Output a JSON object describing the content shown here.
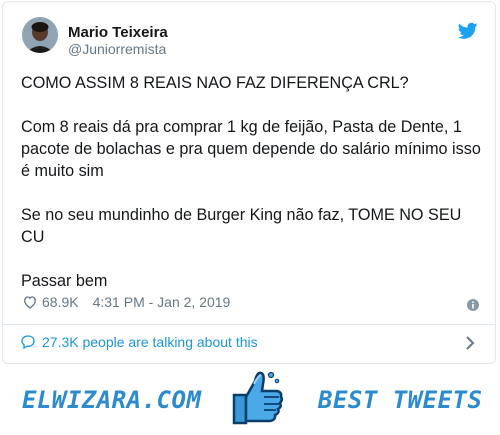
{
  "tweet": {
    "display_name": "Mario Teixeira",
    "handle": "@Juniorremista",
    "lines": [
      "COMO ASSIM 8 REAIS NAO FAZ DIFERENÇA CRL?",
      "Com 8 reais dá pra comprar 1 kg de feijão, Pasta de Dente, 1 pacote de bolachas e pra quem depende do salário mínimo isso é muito sim",
      "Se no seu mundinho de Burger King não faz, TOME NO SEU CU",
      "Passar bem"
    ],
    "likes": "68.9K",
    "timestamp": "4:31 PM - Jan 2, 2019",
    "talking": "27.3K people are talking about this"
  },
  "footer": {
    "left_brand": "ELWIZARA.COM",
    "right_brand": "BEST TWEETS"
  },
  "colors": {
    "accent": "#1da1f2",
    "link": "#1b95e0",
    "brand": "#2c8bcf",
    "muted": "#657786"
  },
  "icons": [
    "twitter-bird-icon",
    "heart-icon",
    "info-icon",
    "speech-bubble-icon",
    "chevron-right-icon",
    "thumbs-up-icon"
  ]
}
